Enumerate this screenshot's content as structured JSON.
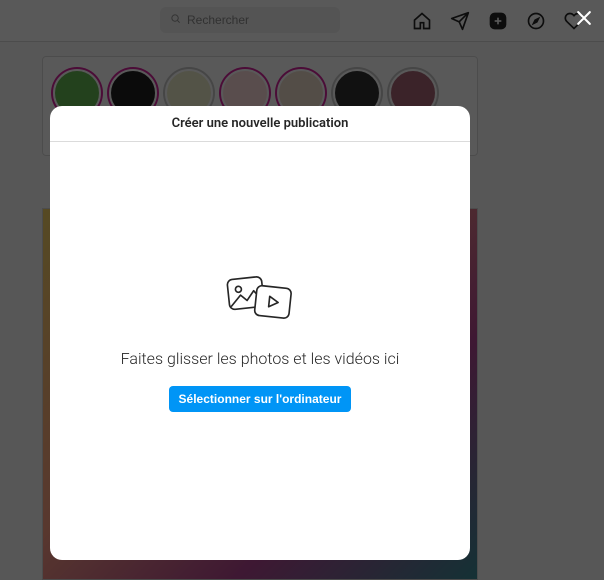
{
  "search": {
    "placeholder": "Rechercher"
  },
  "modal": {
    "title": "Créer une nouvelle publication",
    "drag_text": "Faites glisser les photos et les vidéos ici",
    "select_button": "Sélectionner sur l'ordinateur"
  },
  "icons": {
    "home": "home-icon",
    "messenger": "paper-plane-icon",
    "new_post": "plus-square-icon",
    "explore": "compass-icon",
    "activity": "heart-icon",
    "close": "close-icon",
    "search": "magnifier-icon",
    "media": "photo-video-icon"
  }
}
